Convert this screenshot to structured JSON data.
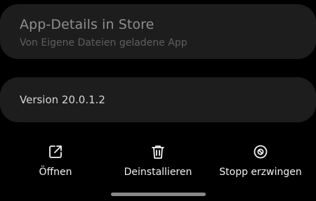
{
  "store_card": {
    "title": "App-Details in Store",
    "subtitle": "Von Eigene Dateien geladene App"
  },
  "version_card": {
    "text": "Version 20.0.1.2"
  },
  "actions": [
    {
      "label": "Öffnen",
      "icon": "open-external-icon"
    },
    {
      "label": "Deinstallieren",
      "icon": "trash-icon"
    },
    {
      "label": "Stopp erzwingen",
      "icon": "block-icon"
    }
  ],
  "colors": {
    "background": "#000000",
    "card": "#1d1d1d",
    "text_primary": "#f2f2f2",
    "text_muted": "#8f8f8f"
  }
}
